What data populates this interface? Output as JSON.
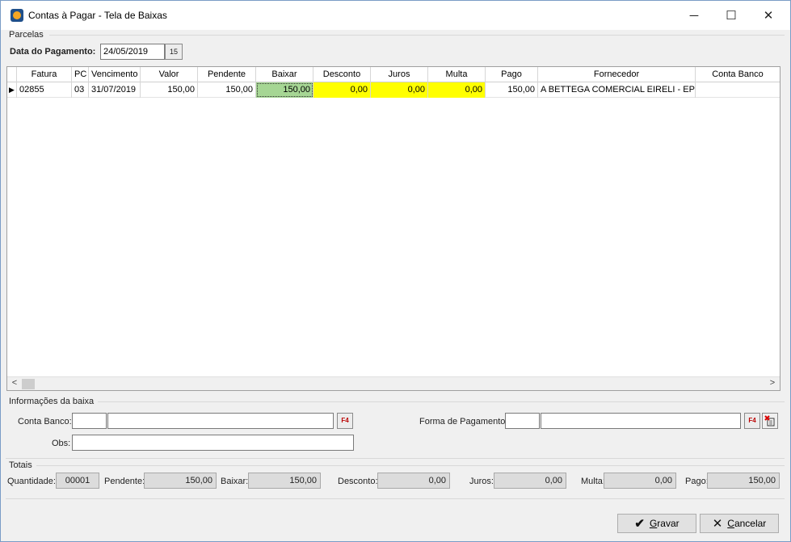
{
  "window": {
    "title": "Contas à Pagar - Tela de Baixas",
    "minimize_glyph": "─",
    "maximize_glyph": "☐",
    "close_glyph": "✕"
  },
  "parcelas": {
    "group_label": "Parcelas",
    "data_pagamento_label": "Data do Pagamento:",
    "data_pagamento_value": "24/05/2019",
    "calendar_glyph": "15"
  },
  "grid": {
    "columns": [
      "",
      "Fatura",
      "PC",
      "Vencimento",
      "Valor",
      "Pendente",
      "Baixar",
      "Desconto",
      "Juros",
      "Multa",
      "Pago",
      "Fornecedor",
      "Conta Banco"
    ],
    "rows": [
      {
        "indicator": "▶",
        "fatura": "02855",
        "pc": "03",
        "vencimento": "31/07/2019",
        "valor": "150,00",
        "pendente": "150,00",
        "baixar": "150,00",
        "desconto": "0,00",
        "juros": "0,00",
        "multa": "0,00",
        "pago": "150,00",
        "fornecedor": "A BETTEGA COMERCIAL EIRELI - EPP",
        "conta_banco": ""
      }
    ],
    "scroll_left_glyph": "<",
    "scroll_right_glyph": ">"
  },
  "informacoes": {
    "group_label": "Informações da baixa",
    "conta_banco_label": "Conta Banco:",
    "conta_banco_code": "",
    "conta_banco_desc": "",
    "forma_pagamento_label": "Forma de Pagamento:",
    "forma_pagamento_code": "",
    "forma_pagamento_desc": "",
    "obs_label": "Obs:",
    "obs_value": "",
    "lookup_glyph": "F4"
  },
  "totais": {
    "group_label": "Totais",
    "quantidade_label": "Quantidade:",
    "quantidade": "00001",
    "pendente_label": "Pendente:",
    "pendente": "150,00",
    "baixar_label": "Baixar:",
    "baixar": "150,00",
    "desconto_label": "Desconto:",
    "desconto": "0,00",
    "juros_label": "Juros:",
    "juros": "0,00",
    "multa_label": "Multa:",
    "multa": "0,00",
    "pago_label": "Pago:",
    "pago": "150,00"
  },
  "buttons": {
    "gravar_mnemonic": "G",
    "gravar_rest": "ravar",
    "cancelar_mnemonic": "C",
    "cancelar_rest": "ancelar"
  },
  "colors": {
    "editable_yellow": "#ffff00",
    "selected_green": "#a6d694"
  }
}
